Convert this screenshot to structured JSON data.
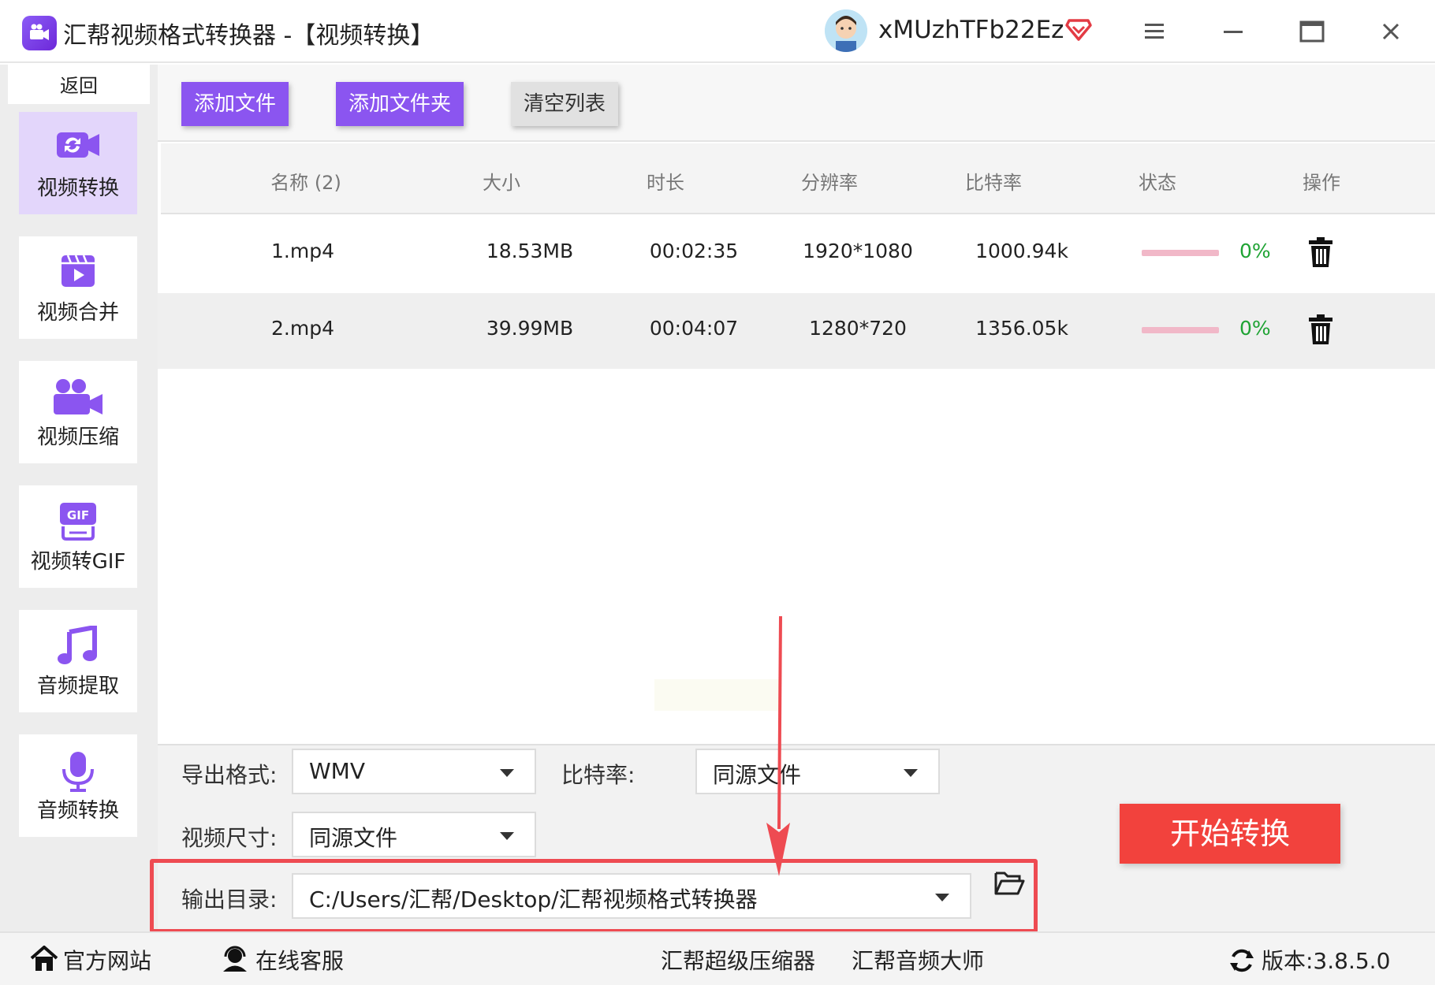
{
  "titlebar": {
    "app_title": "汇帮视频格式转换器   -【视频转换】",
    "username": "xMUzhTFb22Ez"
  },
  "sidebar": {
    "back_label": "返回",
    "items": [
      {
        "label": "视频转换",
        "icon": "video-convert-icon",
        "active": true
      },
      {
        "label": "视频合并",
        "icon": "video-merge-icon",
        "active": false
      },
      {
        "label": "视频压缩",
        "icon": "video-compress-icon",
        "active": false
      },
      {
        "label": "视频转GIF",
        "icon": "gif-icon",
        "active": false
      },
      {
        "label": "音频提取",
        "icon": "music-note-icon",
        "active": false
      },
      {
        "label": "音频转换",
        "icon": "microphone-icon",
        "active": false
      }
    ]
  },
  "toolbar": {
    "add_file": "添加文件",
    "add_folder": "添加文件夹",
    "clear_list": "清空列表"
  },
  "table": {
    "headers": [
      "名称 (2)",
      "大小",
      "时长",
      "分辨率",
      "比特率",
      "状态",
      "操作"
    ],
    "rows": [
      {
        "name": "1.mp4",
        "size": "18.53MB",
        "duration": "00:02:35",
        "resolution": "1920*1080",
        "bitrate": "1000.94k",
        "progress": 0,
        "status": "0%"
      },
      {
        "name": "2.mp4",
        "size": "39.99MB",
        "duration": "00:04:07",
        "resolution": "1280*720",
        "bitrate": "1356.05k",
        "progress": 0,
        "status": "0%"
      }
    ]
  },
  "settings": {
    "format_label": "导出格式:",
    "format_value": "WMV",
    "bitrate_label": "比特率:",
    "bitrate_value": "同源文件",
    "size_label": "视频尺寸:",
    "size_value": "同源文件",
    "output_label": "输出目录:",
    "output_value": "C:/Users/汇帮/Desktop/汇帮视频格式转换器",
    "start_button": "开始转换"
  },
  "footer": {
    "website": "官方网站",
    "support": "在线客服",
    "compressor": "汇帮超级压缩器",
    "audio_master": "汇帮音频大师",
    "version": "版本:3.8.5.0"
  },
  "colors": {
    "accent": "#8b55f0",
    "start": "#f2423d",
    "highlight": "#ee4b52",
    "progress_track": "#f1b8c8",
    "status_green": "#1fa334"
  }
}
